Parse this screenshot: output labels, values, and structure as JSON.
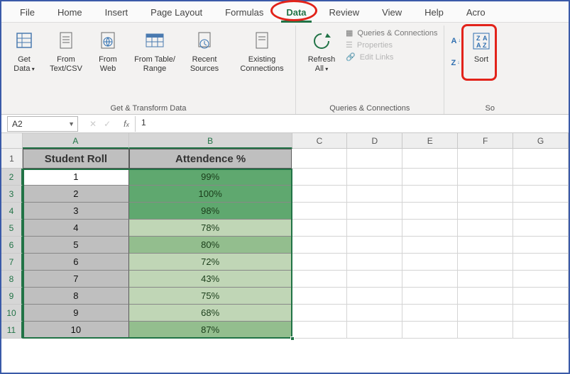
{
  "tabs": {
    "file": "File",
    "home": "Home",
    "insert": "Insert",
    "page_layout": "Page Layout",
    "formulas": "Formulas",
    "data": "Data",
    "review": "Review",
    "view": "View",
    "help": "Help",
    "acrobat": "Acro"
  },
  "active_tab": "Data",
  "ribbon": {
    "gt": {
      "get_data": "Get Data",
      "from_textcsv": "From Text/CSV",
      "from_web": "From Web",
      "from_table": "From Table/ Range",
      "recent": "Recent Sources",
      "existing": "Existing Connections",
      "group_title": "Get & Transform Data"
    },
    "qc": {
      "refresh": "Refresh All",
      "queries": "Queries & Connections",
      "properties": "Properties",
      "edit_links": "Edit Links",
      "group_title": "Queries & Connections"
    },
    "sort": {
      "az": "A→Z",
      "za": "Z→A",
      "sort_btn": "Sort",
      "group_title": "So"
    }
  },
  "namebox": "A2",
  "formula_bar_value": "1",
  "columns": [
    "A",
    "B",
    "C",
    "D",
    "E",
    "F",
    "G"
  ],
  "row_numbers": [
    1,
    2,
    3,
    4,
    5,
    6,
    7,
    8,
    9,
    10,
    11
  ],
  "headers": {
    "a": "Student Roll",
    "b": "Attendence %"
  },
  "chart_data": {
    "type": "table",
    "columns": [
      "Student Roll",
      "Attendence %"
    ],
    "rows": [
      {
        "roll": 1,
        "att": "99%",
        "att_num": 99,
        "shade": "high"
      },
      {
        "roll": 2,
        "att": "100%",
        "att_num": 100,
        "shade": "high"
      },
      {
        "roll": 3,
        "att": "98%",
        "att_num": 98,
        "shade": "high"
      },
      {
        "roll": 4,
        "att": "78%",
        "att_num": 78,
        "shade": "low"
      },
      {
        "roll": 5,
        "att": "80%",
        "att_num": 80,
        "shade": "mid"
      },
      {
        "roll": 6,
        "att": "72%",
        "att_num": 72,
        "shade": "low"
      },
      {
        "roll": 7,
        "att": "43%",
        "att_num": 43,
        "shade": "low"
      },
      {
        "roll": 8,
        "att": "75%",
        "att_num": 75,
        "shade": "low"
      },
      {
        "roll": 9,
        "att": "68%",
        "att_num": 68,
        "shade": "low"
      },
      {
        "roll": 10,
        "att": "87%",
        "att_num": 87,
        "shade": "mid"
      }
    ]
  },
  "attendance_colors": {
    "high": "#5fa86f",
    "mid": "#93be8e",
    "low": "#c0d6b6"
  },
  "annotations": {
    "data_tab_highlighted": true,
    "sort_button_highlighted": true
  }
}
